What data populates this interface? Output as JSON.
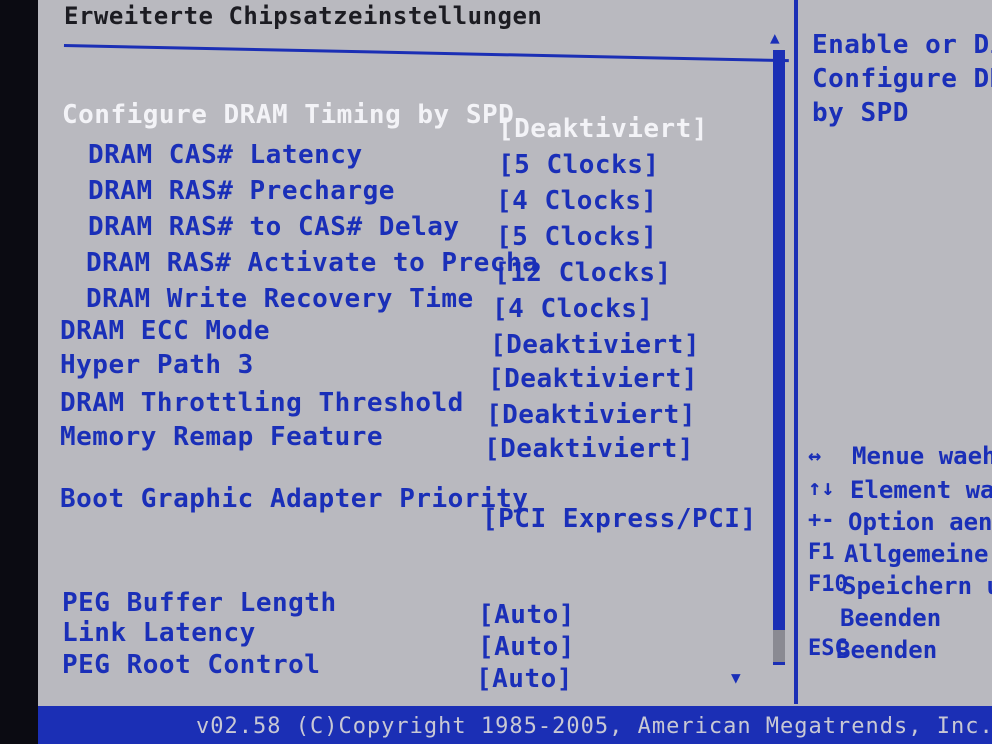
{
  "title": "Erweiterte Chipsatzeinstellungen",
  "settings": [
    {
      "label": "Configure DRAM Timing by SPD",
      "value": "[Deaktiviert]"
    },
    {
      "label": "DRAM CAS# Latency",
      "value": "[5 Clocks]"
    },
    {
      "label": "DRAM RAS# Precharge",
      "value": "[4 Clocks]"
    },
    {
      "label": "DRAM RAS# to CAS# Delay",
      "value": "[5 Clocks]"
    },
    {
      "label": "DRAM RAS# Activate to Precha",
      "value": "[12 Clocks]"
    },
    {
      "label": "DRAM Write Recovery Time",
      "value": "[4 Clocks]"
    },
    {
      "label": "DRAM ECC Mode",
      "value": "[Deaktiviert]"
    },
    {
      "label": "Hyper Path 3",
      "value": "[Deaktiviert]"
    },
    {
      "label": "DRAM Throttling Threshold",
      "value": "[Deaktiviert]"
    },
    {
      "label": "Memory Remap Feature",
      "value": "[Deaktiviert]"
    },
    {
      "label": "Boot Graphic Adapter Priority",
      "value": "[PCI Express/PCI]"
    },
    {
      "label": "PEG Buffer Length",
      "value": "[Auto]"
    },
    {
      "label": "Link Latency",
      "value": "[Auto]"
    },
    {
      "label": "PEG Root Control",
      "value": "[Auto]"
    }
  ],
  "help": {
    "line1": "Enable or Disa",
    "line2": "Configure DRAM",
    "line3": "by SPD"
  },
  "keys": [
    {
      "key": "↔",
      "desc": "Menue waehle"
    },
    {
      "key": "↑↓",
      "desc": "Element waeh"
    },
    {
      "key": "+-",
      "desc": "Option aende"
    },
    {
      "key": "F1",
      "desc": "Allgemeine H"
    },
    {
      "key": "F10",
      "desc": "Speichern und"
    },
    {
      "key": "",
      "desc": "Beenden"
    },
    {
      "key": "ESC",
      "desc": "Beenden"
    }
  ],
  "footer": "v02.58 (C)Copyright 1985-2005, American Megatrends, Inc.",
  "icons": {
    "scroll_up": "triangle-up-icon",
    "scroll_down": "triangle-down-icon"
  },
  "colors": {
    "background": "#b9b9bf",
    "accent": "#1b2fb5",
    "selected_text": "#f3f3f7"
  }
}
